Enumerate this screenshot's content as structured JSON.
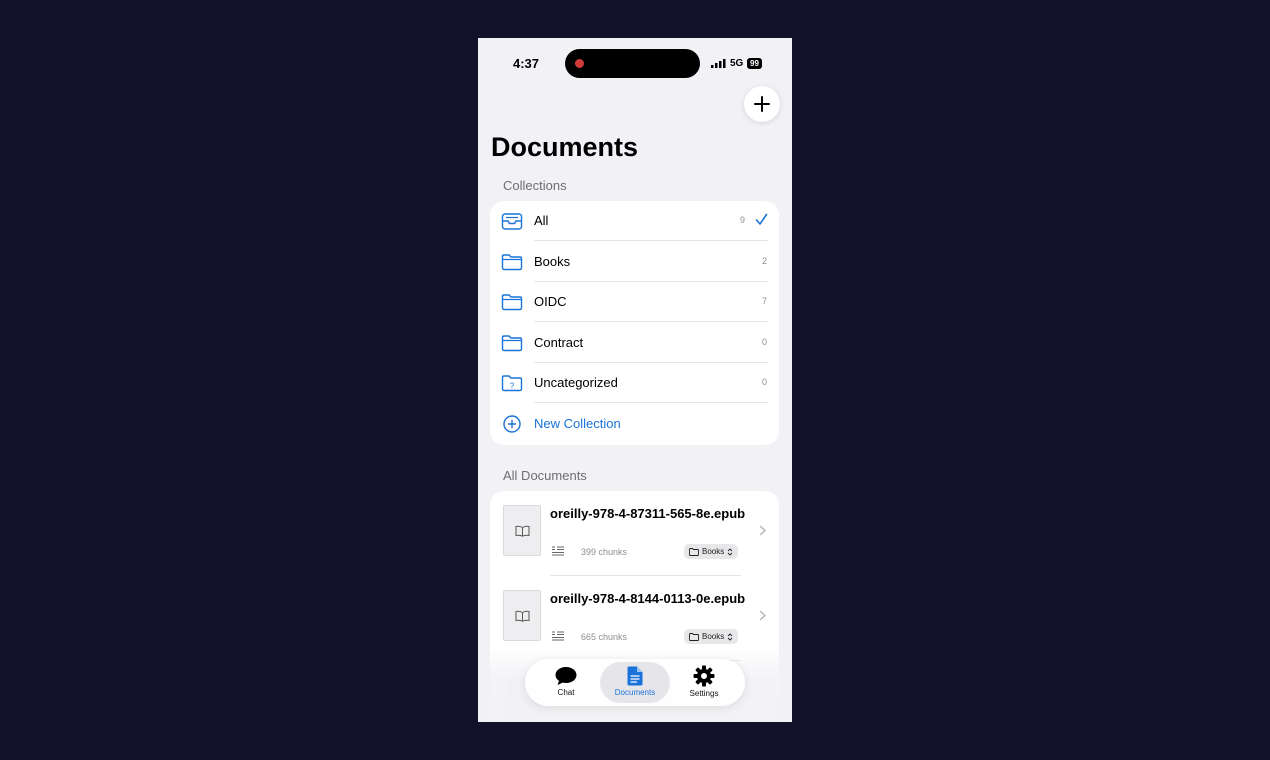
{
  "status_bar": {
    "time": "4:37",
    "network": "5G",
    "battery": "99"
  },
  "page": {
    "title": "Documents"
  },
  "collections": {
    "header": "Collections",
    "items": [
      {
        "label": "All",
        "count": "9",
        "selected": true,
        "icon": "tray-icon"
      },
      {
        "label": "Books",
        "count": "2",
        "icon": "folder-icon"
      },
      {
        "label": "OIDC",
        "count": "7",
        "icon": "folder-icon"
      },
      {
        "label": "Contract",
        "count": "0",
        "icon": "folder-icon"
      },
      {
        "label": "Uncategorized",
        "count": "0",
        "icon": "folder-question-icon"
      }
    ],
    "new_label": "New Collection"
  },
  "documents": {
    "header": "All Documents",
    "items": [
      {
        "name": "oreilly-978-4-87311-565-8e.epub",
        "chunks": "399 chunks",
        "collection": "Books"
      },
      {
        "name": "oreilly-978-4-8144-0113-0e.epub",
        "chunks": "665 chunks",
        "collection": "Books"
      }
    ]
  },
  "tabs": [
    {
      "label": "Chat",
      "icon": "chat-bubble-icon"
    },
    {
      "label": "Documents",
      "icon": "document-icon",
      "active": true
    },
    {
      "label": "Settings",
      "icon": "gear-icon"
    }
  ],
  "colors": {
    "accent": "#1a73d9",
    "background": "#f2f2f6"
  }
}
